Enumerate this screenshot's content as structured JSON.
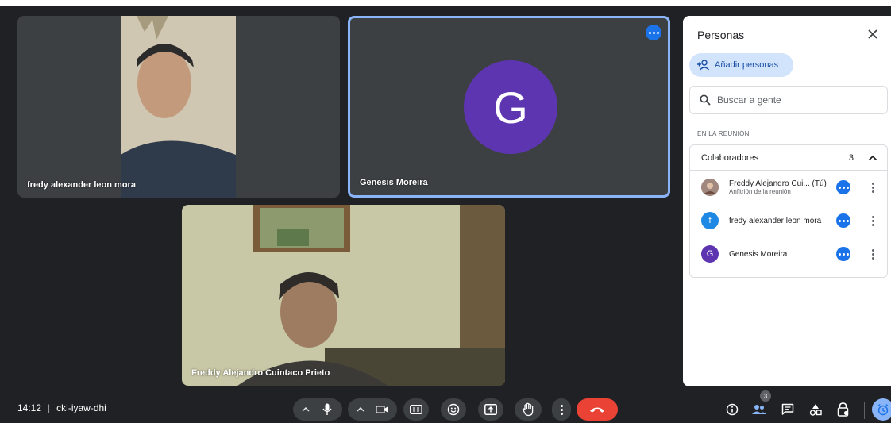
{
  "tiles": [
    {
      "name": "fredy alexander leon mora"
    },
    {
      "name": "Genesis Moreira",
      "avatar_letter": "G"
    },
    {
      "name": "Freddy Alejandro Cuintaco Prieto"
    }
  ],
  "panel": {
    "title": "Personas",
    "add_label": "Añadir personas",
    "search_placeholder": "Buscar a gente",
    "section_label": "EN LA REUNIÓN",
    "group_label": "Colaboradores",
    "group_count": "3",
    "people": [
      {
        "name": "Freddy Alejandro Cui... (Tú)",
        "subtitle": "Anfitrión de la reunión",
        "avatar_letter": "",
        "avatar_color": "#8d6e63"
      },
      {
        "name": "fredy alexander leon mora",
        "subtitle": "",
        "avatar_letter": "f",
        "avatar_color": "#1e88e5"
      },
      {
        "name": "Genesis Moreira",
        "subtitle": "",
        "avatar_letter": "G",
        "avatar_color": "#5e35b1"
      }
    ]
  },
  "bottombar": {
    "time": "14:12",
    "separator": "|",
    "meeting_code": "cki-iyaw-dhi",
    "people_badge": "3"
  },
  "colors": {
    "accent": "#1a73e8",
    "end_call": "#ea4335",
    "background": "#202124"
  }
}
